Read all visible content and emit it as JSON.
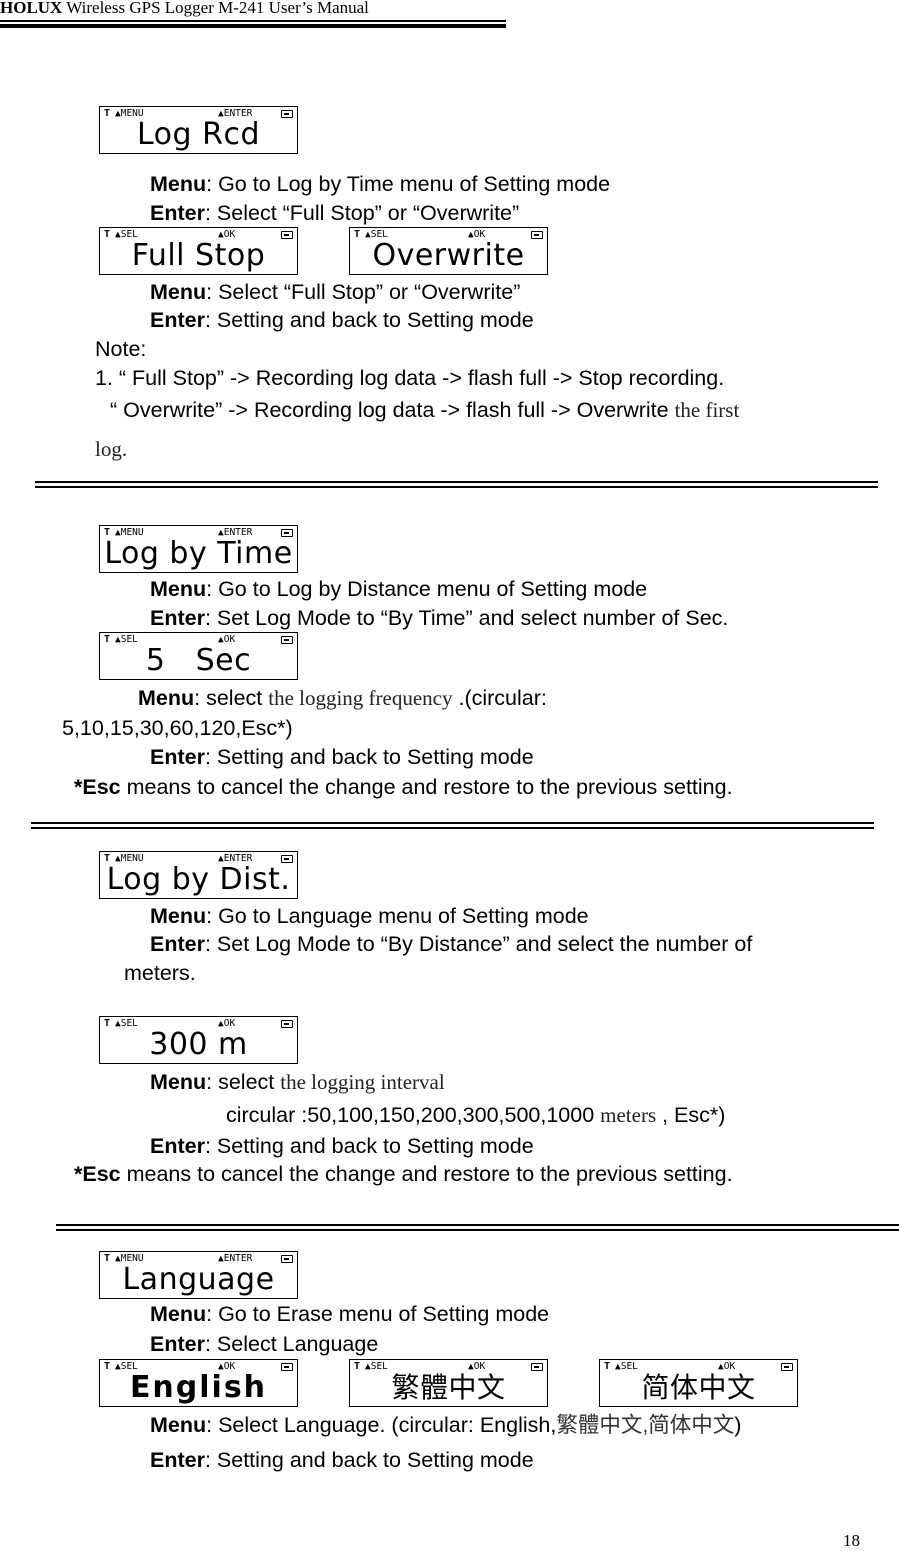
{
  "header": {
    "brand": "HOLUX",
    "title": " Wireless GPS Logger M-241 User’s Manual"
  },
  "lcd_icons": {
    "antenna": "antenna-icon",
    "key": "key-icon",
    "battery": "battery-icon"
  },
  "sections": {
    "log_rcd": {
      "screen": {
        "left_key": "▲MENU",
        "right_key": "▲ENTER",
        "text": "Log Rcd"
      },
      "menu_label": "Menu",
      "menu_text": ": Go to Log by Time menu of Setting mode",
      "enter_label": "Enter",
      "enter_text": ": Select “Full Stop” or “Overwrite”",
      "options": [
        {
          "left_key": "▲SEL",
          "right_key": "▲OK",
          "text": "Full Stop"
        },
        {
          "left_key": "▲SEL",
          "right_key": "▲OK",
          "text": "Overwrite"
        }
      ],
      "menu2_label": "Menu",
      "menu2_text": ": Select “Full Stop” or “Overwrite”",
      "enter2_label": "Enter",
      "enter2_text": ": Setting and back to Setting mode",
      "note_title": "Note:",
      "note_line1": "1.    “ Full Stop” -> Recording log data -> flash full -> Stop recording.",
      "note_line2": "“ Overwrite” -> Recording log data -> flash full -> Overwrite ",
      "note_line2_serif": "the first",
      "note_line3_serif": "log."
    },
    "log_by_time": {
      "screen": {
        "left_key": "▲MENU",
        "right_key": "▲ENTER",
        "text": "Log by Time"
      },
      "menu_label": "Menu",
      "menu_text": ": Go to Log by Distance menu of Setting mode",
      "enter_label": "Enter",
      "enter_text": ": Set Log Mode to “By Time” and select number of Sec.",
      "value_screen": {
        "left_key": "▲SEL",
        "right_key": "▲OK",
        "text": "5   Sec"
      },
      "menu2_label": "Menu",
      "menu2_pre": ": select ",
      "menu2_serif": "the logging frequency",
      "menu2_post": " .(circular:",
      "menu2_cont": "5,10,15,30,60,120,Esc*)",
      "enter2_label": "Enter",
      "enter2_text": ": Setting and back to Setting mode",
      "esc_label": "*Esc",
      "esc_text": " means to cancel the change and restore to the previous setting."
    },
    "log_by_dist": {
      "screen": {
        "left_key": "▲MENU",
        "right_key": "▲ENTER",
        "text": "Log by Dist."
      },
      "menu_label": "Menu",
      "menu_text": ": Go to Language menu of Setting mode",
      "enter_label": "Enter",
      "enter_text": ": Set Log Mode to “By Distance” and select the number of",
      "enter_cont": "meters.",
      "value_screen": {
        "left_key": "▲SEL",
        "right_key": "▲OK",
        "text": "300 m"
      },
      "menu2_label": "Menu",
      "menu2_pre": ": select ",
      "menu2_serif": "the logging interval",
      "menu2_cont_pre": "circular :50,100,150,200,300,500,1000 ",
      "menu2_cont_serif": "meters",
      "menu2_cont_post": " , Esc*)",
      "enter2_label": "Enter",
      "enter2_text": ": Setting and back to Setting mode",
      "esc_label": "*Esc",
      "esc_text": " means to cancel the change and restore to the previous setting."
    },
    "language": {
      "screen": {
        "left_key": "▲MENU",
        "right_key": "▲ENTER",
        "text": "Language"
      },
      "menu_label": "Menu",
      "menu_text": ": Go to Erase menu of Setting mode",
      "enter_label": "Enter",
      "enter_text": ": Select Language",
      "options": [
        {
          "left_key": "▲SEL",
          "right_key": "▲OK",
          "text": "English"
        },
        {
          "left_key": "▲SEL",
          "right_key": "▲OK",
          "text": "繁體中文"
        },
        {
          "left_key": "▲SEL",
          "right_key": "▲OK",
          "text": "简体中文"
        }
      ],
      "menu2_label": "Menu",
      "menu2_text": ": Select Language. (circular: English,",
      "menu2_cjk": "繁體中文,简体中文",
      "menu2_end": ")",
      "enter2_label": "Enter",
      "enter2_text": ": Setting and back to Setting mode"
    }
  },
  "footer": {
    "page_number": "18"
  }
}
